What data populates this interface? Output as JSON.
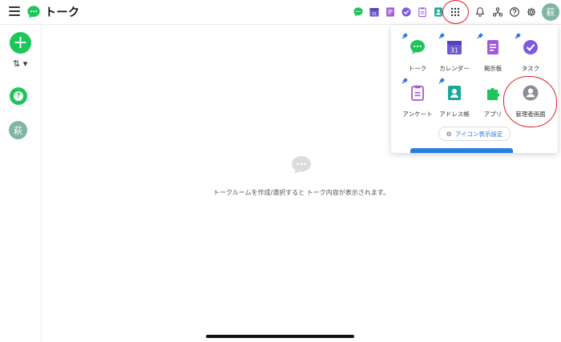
{
  "header": {
    "title": "トーク",
    "avatar_text": "萩",
    "icons": [
      "talk-icon",
      "calendar-icon",
      "board-icon",
      "task-icon",
      "survey-icon",
      "address-icon",
      "apps-grid-icon",
      "bell-icon",
      "org-icon",
      "help-icon",
      "settings-icon"
    ]
  },
  "calendar_day": "31",
  "sidebar": {
    "add_label": "+",
    "sort_label": "⇅ ▾",
    "help_label": "?",
    "avatar_text": "萩"
  },
  "main": {
    "empty_message": "トークルームを作成/選択すると トーク内容が表示されます。"
  },
  "apps_panel": {
    "apps": [
      {
        "label": "トーク"
      },
      {
        "label": "カレンダー"
      },
      {
        "label": "掲示板"
      },
      {
        "label": "タスク"
      },
      {
        "label": "アンケート"
      },
      {
        "label": "アドレス帳"
      },
      {
        "label": "アプリ"
      },
      {
        "label": "管理者画面"
      }
    ],
    "settings_label": "アイコン表示設定"
  },
  "colors": {
    "brand_green": "#1ec55b",
    "calendar_purple": "#6a5acd",
    "board_purple": "#a25ad9",
    "task_purple": "#7a5be0",
    "address_teal": "#1aa89a",
    "link_blue": "#2a7de1",
    "annotation_red": "#e0242a",
    "avatar": "#7fb6a3"
  }
}
